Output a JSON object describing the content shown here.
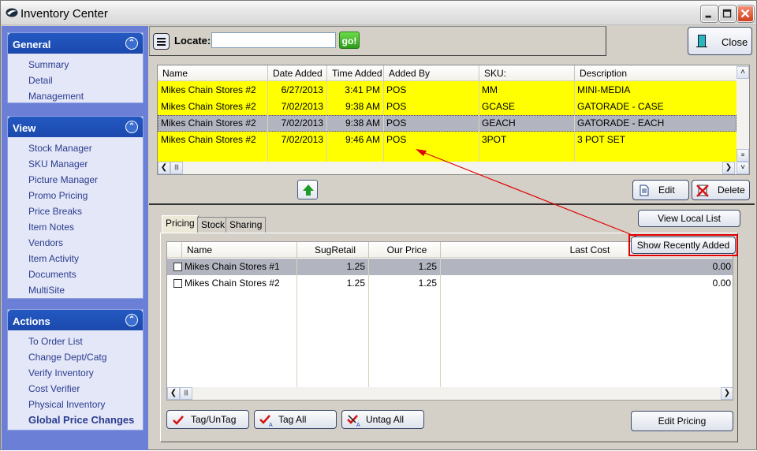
{
  "window": {
    "title": "Inventory Center",
    "controls": {
      "minimize": "minimize",
      "maximize": "maximize",
      "close": "close"
    }
  },
  "sidebar": {
    "sections": [
      {
        "title": "General",
        "items": [
          "Summary",
          "Detail",
          "Management"
        ]
      },
      {
        "title": "View",
        "items": [
          "Stock Manager",
          "SKU Manager",
          "Picture Manager",
          "Promo Pricing",
          "Price Breaks",
          "Item Notes",
          "Vendors",
          "Item Activity",
          "Documents",
          "MultiSite"
        ]
      },
      {
        "title": "Actions",
        "items": [
          "To Order List",
          "Change Dept/Catg",
          "Verify Inventory",
          "Cost Verifier",
          "Physical Inventory",
          "Global Price Changes"
        ]
      }
    ]
  },
  "toolbar": {
    "locate_label": "Locate:",
    "locate_value": "",
    "go_label": "go!",
    "close_label": "Close"
  },
  "items_grid": {
    "columns": [
      "Name",
      "Date Added",
      "Time Added",
      "Added By",
      "SKU:",
      "Description"
    ],
    "rows": [
      {
        "name": "Mikes Chain Stores #2",
        "date": "6/27/2013",
        "time": "3:41 PM",
        "by": "POS",
        "sku": "MM",
        "desc": "MINI-MEDIA",
        "state": "highlighted"
      },
      {
        "name": "Mikes Chain Stores #2",
        "date": "7/02/2013",
        "time": "9:38 AM",
        "by": "POS",
        "sku": "GCASE",
        "desc": "GATORADE - CASE",
        "state": "highlighted"
      },
      {
        "name": "Mikes Chain Stores #2",
        "date": "7/02/2013",
        "time": "9:38 AM",
        "by": "POS",
        "sku": "GEACH",
        "desc": "GATORADE - EACH",
        "state": "selected"
      },
      {
        "name": "Mikes Chain Stores #2",
        "date": "7/02/2013",
        "time": "9:46 AM",
        "by": "POS",
        "sku": "3POT",
        "desc": "3 POT SET",
        "state": "highlighted"
      }
    ],
    "highlight_color": "#ffff00",
    "selected_color": "#b2b4bf"
  },
  "upper_actions": {
    "edit_label": "Edit",
    "delete_label": "Delete"
  },
  "right_actions": {
    "view_local_list": "View Local List",
    "show_recently_added": "Show Recently Added"
  },
  "tabs": [
    "Pricing",
    "Stock",
    "Sharing"
  ],
  "active_tab": "Pricing",
  "pricing_grid": {
    "columns": [
      "Name",
      "SugRetail",
      "Our Price",
      "Last Cost"
    ],
    "rows": [
      {
        "checked": false,
        "name": "Mikes Chain Stores #1",
        "sug_retail": "1.25",
        "our_price": "1.25",
        "last_cost": "0.00",
        "state": "selected"
      },
      {
        "checked": false,
        "name": "Mikes Chain Stores #2",
        "sug_retail": "1.25",
        "our_price": "1.25",
        "last_cost": "0.00",
        "state": "normal"
      }
    ]
  },
  "bottom_actions": {
    "tag_untag": "Tag/UnTag",
    "tag_all": "Tag All",
    "untag_all": "Untag All",
    "edit_pricing": "Edit Pricing"
  },
  "annotation": {
    "color": "#e00000",
    "description": "red arrow from Show Recently Added button to highlighted rows"
  }
}
